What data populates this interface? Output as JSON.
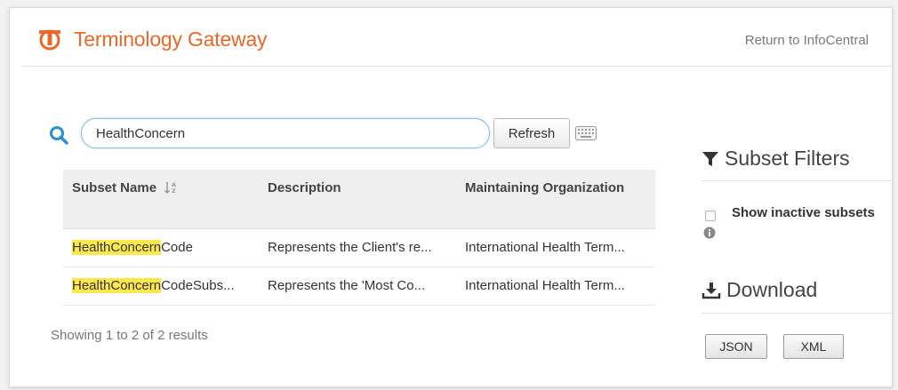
{
  "header": {
    "title": "Terminology Gateway",
    "return_link": "Return to InfoCentral"
  },
  "search": {
    "value": "HealthConcern",
    "refresh_label": "Refresh"
  },
  "table": {
    "columns": [
      "Subset Name",
      "Description",
      "Maintaining Organization"
    ],
    "rows": [
      {
        "name_highlight": "HealthConcern",
        "name_rest": "Code",
        "description": "Represents the Client's re...",
        "organization": "International Health Term..."
      },
      {
        "name_highlight": "HealthConcern",
        "name_rest": "CodeSubs...",
        "description": "Represents the 'Most Co...",
        "organization": "International Health Term..."
      }
    ]
  },
  "results_summary": "Showing 1 to 2 of 2 results",
  "filters": {
    "heading": "Subset Filters",
    "show_inactive_label": "Show inactive subsets"
  },
  "download": {
    "heading": "Download",
    "json_label": "JSON",
    "xml_label": "XML"
  },
  "colors": {
    "brand": "#e8692a",
    "search_icon": "#2a8fd0",
    "highlight": "#ffe84d"
  },
  "icons": [
    "logo-icon",
    "search-icon",
    "keyboard-icon",
    "sort-icon",
    "filter-icon",
    "info-icon",
    "download-icon"
  ]
}
